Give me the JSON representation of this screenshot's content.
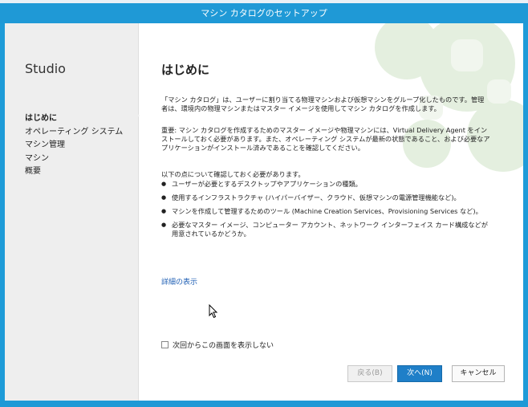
{
  "window": {
    "title": "マシン カタログのセットアップ"
  },
  "sidebar": {
    "title": "Studio",
    "steps": [
      {
        "label": "はじめに",
        "active": true
      },
      {
        "label": "オペレーティング システム",
        "active": false
      },
      {
        "label": "マシン管理",
        "active": false
      },
      {
        "label": "マシン",
        "active": false
      },
      {
        "label": "概要",
        "active": false
      }
    ]
  },
  "main": {
    "title": "はじめに",
    "intro": "「マシン カタログ」は、ユーザーに割り当てる物理マシンおよび仮想マシンをグループ化したものです。管理者は、環境内の物理マシンまたはマスター イメージを使用してマシン カタログを作成します。",
    "important": "重要: マシン カタログを作成するためのマスター イメージや物理マシンには、Virtual Delivery Agent をインストールしておく必要があります。また、オペレーティング システムが最新の状態であること、および必要なアプリケーションがインストール済みであることを確認してください。",
    "checklist_heading": "以下の点について確認しておく必要があります。",
    "checklist": [
      "ユーザーが必要とするデスクトップやアプリケーションの種類。",
      "使用するインフラストラクチャ (ハイパーバイザー、クラウド、仮想マシンの電源管理機能など)。",
      "マシンを作成して管理するためのツール (Machine Creation Services、Provisioning Services など)。",
      "必要なマスター イメージ、コンピューター アカウント、ネットワーク インターフェイス カード構成などが用意されているかどうか。"
    ],
    "details_link": "詳細の表示",
    "dont_show_label": "次回からこの画面を表示しない"
  },
  "buttons": {
    "back": "戻る(B)",
    "next": "次へ(N)",
    "cancel": "キャンセル"
  },
  "colors": {
    "titlebar": "#1f99d6",
    "next_button": "#1f7fc8",
    "link": "#1f5fb4",
    "sidebar": "#eeeeee"
  }
}
